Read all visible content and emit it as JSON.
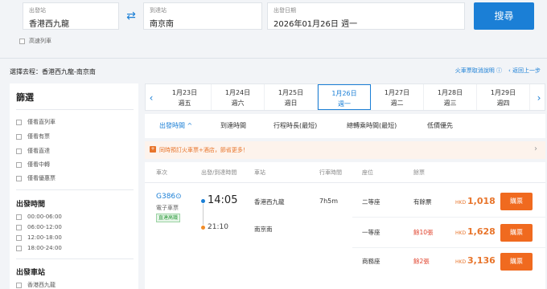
{
  "search": {
    "from_label": "出發站",
    "from_value": "香港西九龍",
    "to_label": "到達站",
    "to_value": "南京南",
    "date_label": "出發日期",
    "date_value": "2026年01月26日 週一",
    "search_button": "搜尋",
    "express_only": "高速列車"
  },
  "route_title": "選擇去程：香港西九龍-南京南",
  "links": {
    "refund_policy": "火車票取消說明 ⓘ",
    "back": "‹ 返回上一步"
  },
  "sidebar": {
    "title": "篩選",
    "options_top": [
      "僅看直列車",
      "僅看有票",
      "僅看直達",
      "僅看中轉",
      "僅看優惠票"
    ],
    "dep_time_title": "出發時間",
    "dep_times": [
      "00:00-06:00",
      "06:00-12:00",
      "12:00-18:00",
      "18:00-24:00"
    ],
    "station_title": "出發車站",
    "stations": [
      "香港西九龍"
    ]
  },
  "dates": [
    {
      "date": "1月23日",
      "weekday": "週五"
    },
    {
      "date": "1月24日",
      "weekday": "週六"
    },
    {
      "date": "1月25日",
      "weekday": "週日"
    },
    {
      "date": "1月26日",
      "weekday": "週一",
      "active": true
    },
    {
      "date": "1月27日",
      "weekday": "週二"
    },
    {
      "date": "1月28日",
      "weekday": "週三"
    },
    {
      "date": "1月29日",
      "weekday": "週四"
    }
  ],
  "sort": [
    "出發時間 ^",
    "到達時間",
    "行程時長(最短)",
    "總轉乘時間(最短)",
    "低價優先"
  ],
  "promo": "同時預訂火車票+酒店，節省更多！",
  "table": {
    "headers": [
      "車次",
      "出發/到達時間",
      "車站",
      "行車時間",
      "座位",
      "餘票"
    ],
    "train": {
      "number": "G386⊙",
      "ticket_type": "電子車票",
      "badge": "直達高鐵",
      "dep_time": "14:05",
      "arr_time": "21:10",
      "dep_station": "香港西九龍",
      "arr_station": "南京南",
      "duration": "7h5m",
      "seats": [
        {
          "class": "二等座",
          "avail": "有餘票",
          "currency": "HKD",
          "price": "1,018",
          "buy": "購票"
        },
        {
          "class": "一等座",
          "avail": "餘10張",
          "currency": "HKD",
          "price": "1,628",
          "buy": "購票"
        },
        {
          "class": "商務座",
          "avail": "餘2張",
          "currency": "HKD",
          "price": "3,136",
          "buy": "購票"
        }
      ]
    }
  },
  "colors": {
    "accent": "#1b7fd6",
    "orange": "#f06a1f",
    "low_stock": "#e0402a",
    "in_stock": "#333333"
  }
}
